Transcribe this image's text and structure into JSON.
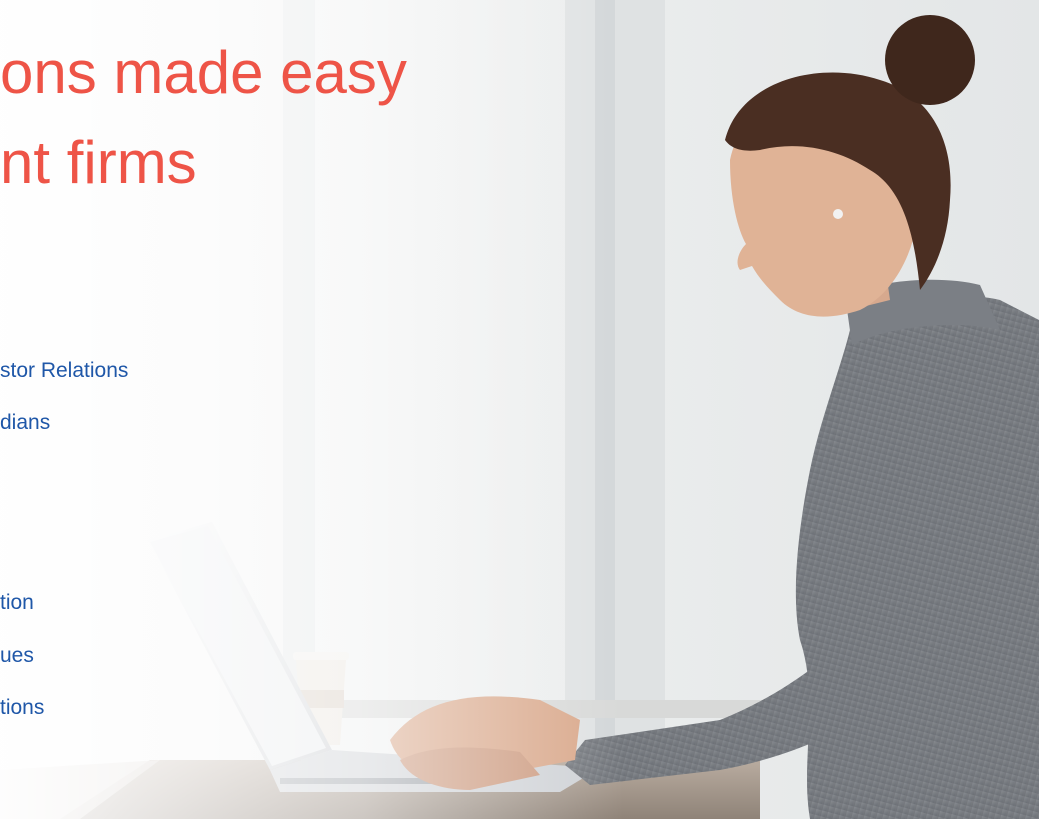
{
  "hero": {
    "headline_line1": "ons made easy",
    "headline_line2": "nt firms"
  },
  "features": {
    "group1": [
      "stor Relations",
      "dians"
    ],
    "group2": [
      "tion",
      "ues",
      "tions"
    ]
  },
  "colors": {
    "headline": "#ee5447",
    "link": "#1f57a8",
    "background": "#eef0f1"
  },
  "image": {
    "description": "woman-typing-on-laptop"
  }
}
